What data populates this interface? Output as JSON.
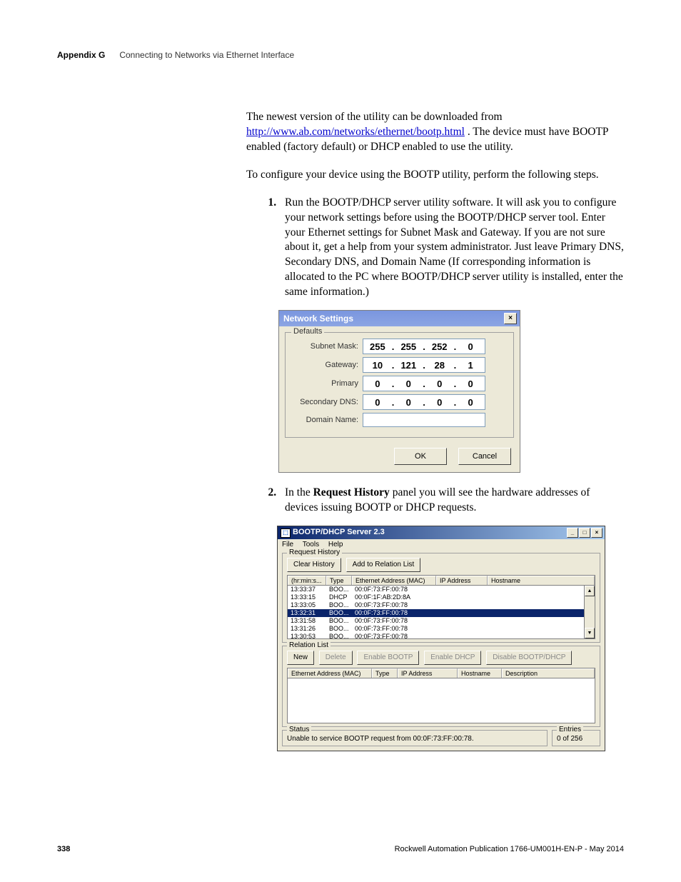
{
  "header": {
    "appendix": "Appendix G",
    "chapter": "Connecting to Networks via Ethernet Interface"
  },
  "intro": {
    "p1a": "The newest version of the utility can be downloaded from ",
    "link": "http://www.ab.com/networks/ethernet/bootp.html",
    "p1b": " . The device must have BOOTP enabled (factory default) or DHCP enabled to use the utility.",
    "p2": "To configure your device using the BOOTP utility, perform the following steps."
  },
  "steps": {
    "s1": "Run the BOOTP/DHCP server utility software. It will ask you to configure your network settings before using the BOOTP/DHCP server tool. Enter your Ethernet settings for Subnet Mask and Gateway. If you are not sure about it, get a help from your system administrator. Just leave Primary DNS, Secondary DNS, and Domain Name (If corresponding information is allocated to the PC where BOOTP/DHCP server utility is installed, enter the same information.)",
    "s2a": "In the ",
    "s2b": "Request History",
    "s2c": " panel you will see the hardware addresses of devices issuing BOOTP or DHCP requests."
  },
  "netdlg": {
    "title": "Network Settings",
    "close": "×",
    "legend": "Defaults",
    "subnet_label": "Subnet Mask:",
    "subnet": [
      "255",
      "255",
      "252",
      "0"
    ],
    "gateway_label": "Gateway:",
    "gateway": [
      "10",
      "121",
      "28",
      "1"
    ],
    "primary_label": "Primary",
    "primary": [
      "0",
      "0",
      "0",
      "0"
    ],
    "secondary_label": "Secondary DNS:",
    "secondary": [
      "0",
      "0",
      "0",
      "0"
    ],
    "domain_label": "Domain Name:",
    "ok": "OK",
    "cancel": "Cancel"
  },
  "bootp": {
    "title": "BOOTP/DHCP Server 2.3",
    "min": "_",
    "max": "□",
    "close": "×",
    "menu": {
      "file": "File",
      "tools": "Tools",
      "help": "Help"
    },
    "req_legend": "Request History",
    "clear": "Clear History",
    "add": "Add to Relation List",
    "cols": {
      "time": "(hr:min:s...",
      "type": "Type",
      "mac": "Ethernet Address (MAC)",
      "ip": "IP Address",
      "host": "Hostname"
    },
    "rows": [
      {
        "t": "13:33:37",
        "ty": "BOO...",
        "m": "00:0F:73:FF:00:78"
      },
      {
        "t": "13:33:15",
        "ty": "DHCP",
        "m": "00:0F:1F:AB:2D:8A"
      },
      {
        "t": "13:33:05",
        "ty": "BOO...",
        "m": "00:0F:73:FF:00:78"
      },
      {
        "t": "13:32:31",
        "ty": "BOO...",
        "m": "00:0F:73:FF:00:78"
      },
      {
        "t": "13:31:58",
        "ty": "BOO...",
        "m": "00:0F:73:FF:00:78"
      },
      {
        "t": "13:31:26",
        "ty": "BOO...",
        "m": "00:0F:73:FF:00:78"
      },
      {
        "t": "13:30:53",
        "ty": "BOO...",
        "m": "00:0F:73:FF:00:78"
      }
    ],
    "rel_legend": "Relation List",
    "new": "New",
    "delete": "Delete",
    "enable_bootp": "Enable BOOTP",
    "enable_dhcp": "Enable DHCP",
    "disable": "Disable BOOTP/DHCP",
    "relcols": {
      "mac": "Ethernet Address (MAC)",
      "type": "Type",
      "ip": "IP Address",
      "host": "Hostname",
      "desc": "Description"
    },
    "status_legend": "Status",
    "status_text": "Unable to service BOOTP request from 00:0F:73:FF:00:78.",
    "entries_legend": "Entries",
    "entries_text": "0 of 256"
  },
  "footer": {
    "page": "338",
    "pub": "Rockwell Automation Publication 1766-UM001H-EN-P - May 2014"
  }
}
